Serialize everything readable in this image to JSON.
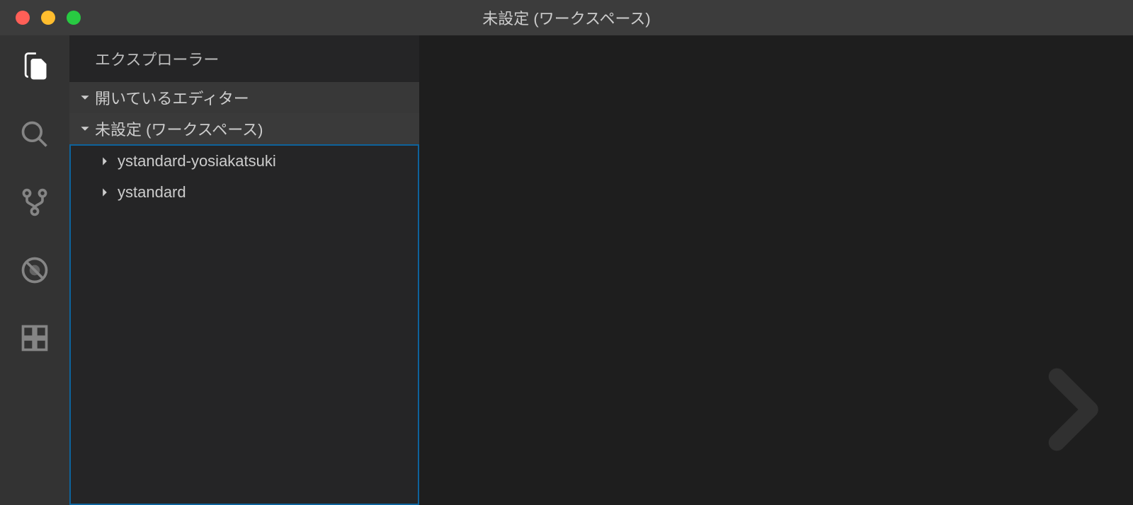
{
  "window": {
    "title": "未設定 (ワークスペース)"
  },
  "activityBar": {
    "items": [
      {
        "name": "explorer",
        "active": true
      },
      {
        "name": "search",
        "active": false
      },
      {
        "name": "source-control",
        "active": false
      },
      {
        "name": "debug",
        "active": false
      },
      {
        "name": "extensions",
        "active": false
      }
    ]
  },
  "sidebar": {
    "title": "エクスプローラー",
    "sections": {
      "openEditors": {
        "label": "開いているエディター",
        "expanded": true
      },
      "workspace": {
        "label": "未設定 (ワークスペース)",
        "expanded": true,
        "folders": [
          {
            "name": "ystandard-yosiakatsuki",
            "expanded": false
          },
          {
            "name": "ystandard",
            "expanded": false
          }
        ]
      }
    }
  }
}
